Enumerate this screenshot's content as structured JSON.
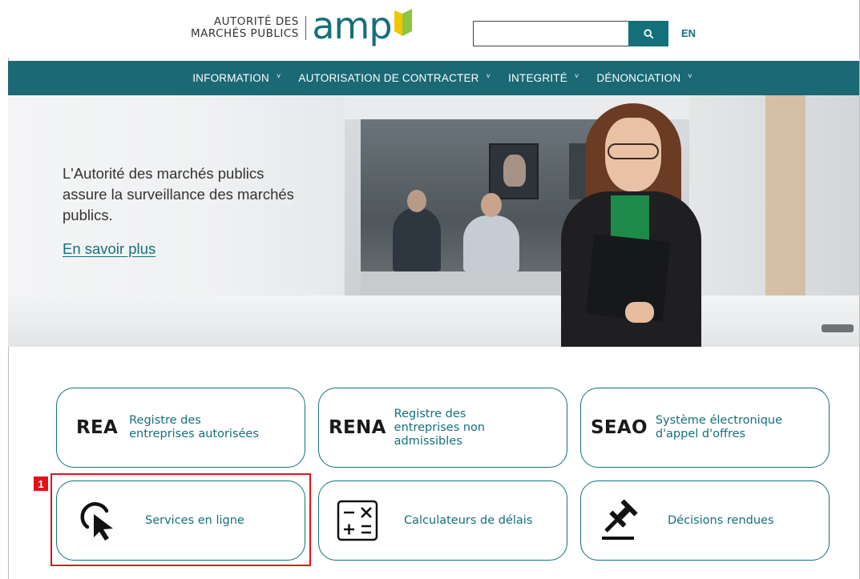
{
  "header": {
    "logo_line1": "AUTORITÉ DES",
    "logo_line2": "MARCHÉS PUBLICS",
    "logo_brand": "amp",
    "search_placeholder": "",
    "search_icon": "search-icon",
    "lang_toggle": "EN",
    "colors": {
      "brand": "#13707a",
      "flag_green": "#8cc63f",
      "flag_yellow": "#f2c500"
    }
  },
  "nav": {
    "items": [
      {
        "label": "INFORMATION",
        "icon": "chevron-down-icon"
      },
      {
        "label": "AUTORISATION DE CONTRACTER",
        "icon": "chevron-down-icon"
      },
      {
        "label": "INTEGRITÉ",
        "icon": "chevron-down-icon"
      },
      {
        "label": "DÉNONCIATION",
        "icon": "chevron-down-icon"
      }
    ],
    "chevron": "˅"
  },
  "hero": {
    "text": "L'Autorité des marchés publics assure la surveillance des marchés publics.",
    "link": "En savoir plus"
  },
  "tiles": [
    {
      "acronym": "REA",
      "label_lines": [
        "Registre des",
        "entreprises autorisées"
      ]
    },
    {
      "acronym": "RENA",
      "label_lines": [
        "Registre des",
        "entreprises non",
        "admissibles"
      ]
    },
    {
      "acronym": "SEAO",
      "label_lines": [
        "Système électronique",
        "d'appel d'offres"
      ]
    },
    {
      "icon": "cursor-click-icon",
      "label": "Services en ligne"
    },
    {
      "icon": "calculator-icon",
      "label": "Calculateurs de délais"
    },
    {
      "icon": "gavel-icon",
      "label": "Décisions rendues"
    }
  ],
  "annotation": {
    "badge": "1",
    "color": "#e0141a"
  }
}
